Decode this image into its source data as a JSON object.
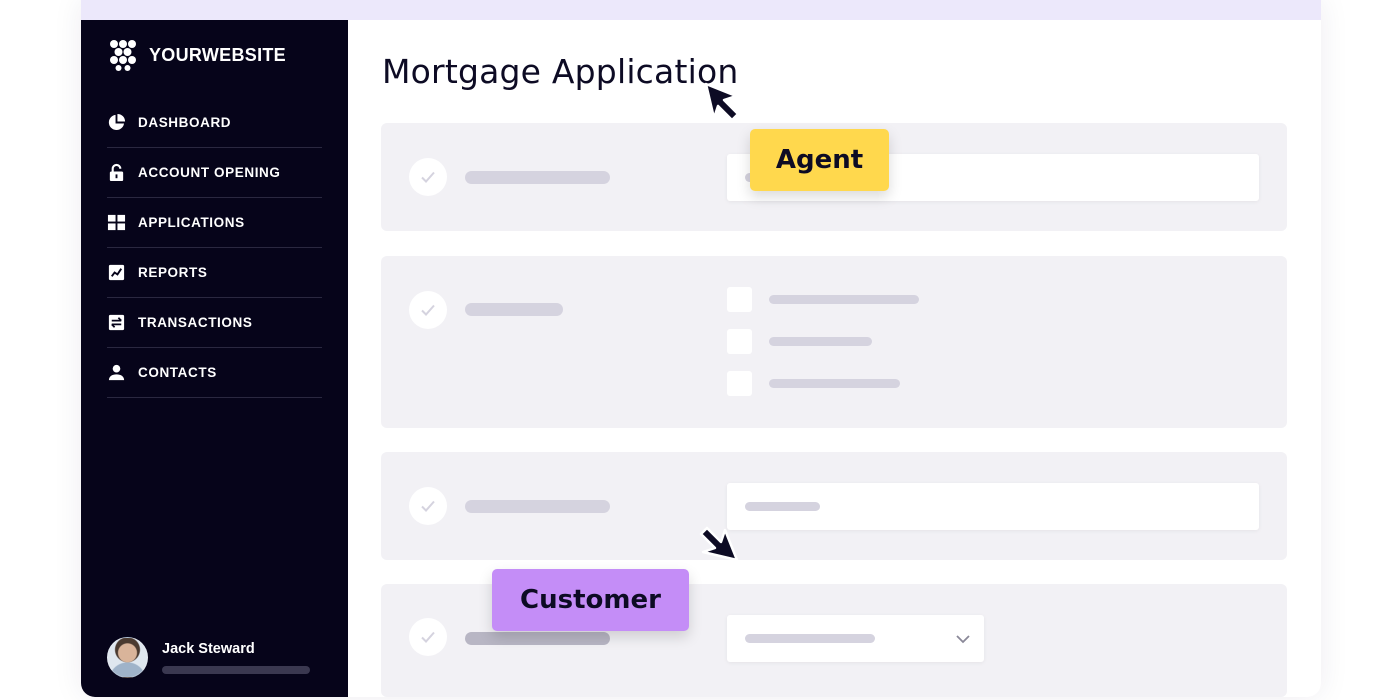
{
  "brand": {
    "name": "YOURWEBSITE",
    "icon": "hexagon-cluster-logo-icon"
  },
  "sidebar": {
    "items": [
      {
        "label": "DASHBOARD",
        "icon": "pie-chart-icon"
      },
      {
        "label": "ACCOUNT OPENING",
        "icon": "unlock-icon"
      },
      {
        "label": "APPLICATIONS",
        "icon": "grid-icon"
      },
      {
        "label": "REPORTS",
        "icon": "report-chart-icon"
      },
      {
        "label": "TRANSACTIONS",
        "icon": "transfer-icon"
      },
      {
        "label": "CONTACTS",
        "icon": "person-icon"
      }
    ],
    "user": {
      "name": "Jack Steward"
    }
  },
  "main": {
    "title": "Mortgage Application"
  },
  "annotations": {
    "agent": {
      "label": "Agent",
      "color": "#ffd84d"
    },
    "customer": {
      "label": "Customer",
      "color": "#c48df7"
    }
  },
  "colors": {
    "sidebar_bg": "#06041a",
    "card_bg": "#f2f1f5",
    "placeholder": "#d5d3df",
    "top_strip": "#ece8fb"
  }
}
